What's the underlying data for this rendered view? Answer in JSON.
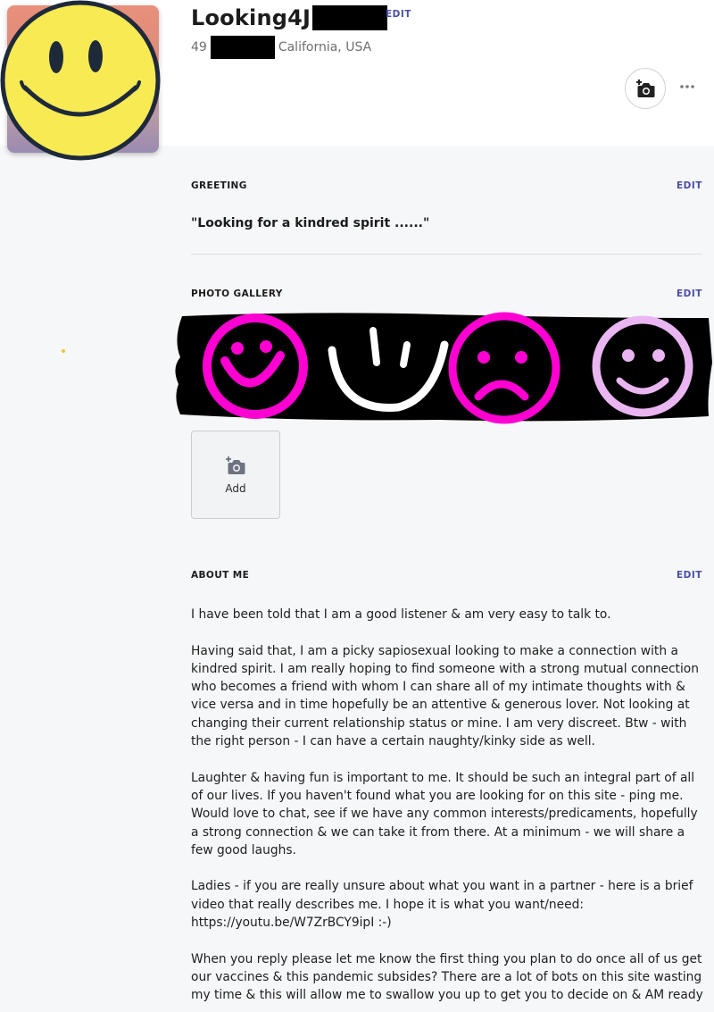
{
  "profile": {
    "username": "Looking4J",
    "username_edit": "EDIT",
    "age": "49",
    "location": "California, USA"
  },
  "actions": {
    "camera_icon": "add-photo-camera-icon",
    "more_icon": "more-options-icon"
  },
  "greeting": {
    "title": "GREETING",
    "edit": "EDIT",
    "text": "\"Looking for a kindred spirit ......\""
  },
  "gallery": {
    "title": "PHOTO GALLERY",
    "edit": "EDIT",
    "add_label": "Add",
    "stickers": [
      "magenta-smiley",
      "white-half-smiley",
      "magenta-frown",
      "lilac-smiley"
    ]
  },
  "about": {
    "title": "ABOUT ME",
    "edit": "EDIT",
    "paragraphs": [
      "I have been told that I am a good listener & am very easy to talk to.",
      "Having said that, I am a picky sapiosexual looking to make a connection with a kindred spirit. I am really hoping to find someone with a strong mutual connection who becomes a friend with whom I can share all of my intimate thoughts with & vice versa and in time hopefully be an attentive & generous lover. Not looking at changing their current relationship status or mine.  I am very discreet. Btw - with the right person - I can have a certain naughty/kinky side as well.",
      "Laughter & having fun is important to me. It should be such an integral part of all of our lives.  If you haven't found what you are looking for on this site - ping me. Would love to chat, see if we have any common interests/predicaments, hopefully a strong connection & we can take it from there.  At a minimum - we will share a few good laughs.",
      "Ladies - if you are really unsure about what you want in a partner - here is a brief video that really describes me.  I hope it is what you want/need: https://youtu.be/W7ZrBCY9ipI    :-)",
      "When you reply please let me know the first thing you plan to do once all of us get our vaccines & this pandemic subsides?  There are a lot of bots on this site wasting my time & this will allow me to swallow you up to get you to decide on & AM ready"
    ]
  },
  "colors": {
    "accent": "#4b4fa3",
    "smiley_yellow": "#f7ea53",
    "magenta": "#ff00d2",
    "lilac": "#eab6f2"
  }
}
